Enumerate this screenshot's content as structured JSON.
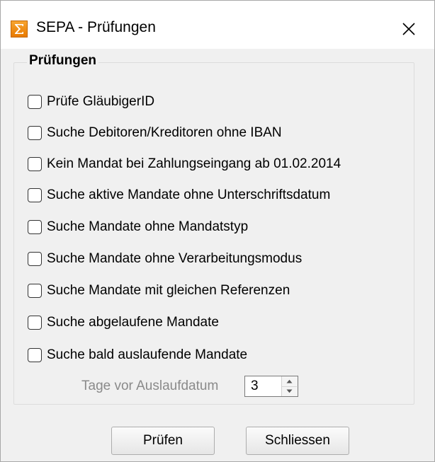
{
  "window": {
    "title": "SEPA - Prüfungen",
    "icon": "sigma-icon",
    "close_icon": "close-icon"
  },
  "group": {
    "legend": "Prüfungen"
  },
  "checks": [
    {
      "label": "Prüfe GläubigerID",
      "checked": false
    },
    {
      "label": "Suche Debitoren/Kreditoren ohne IBAN",
      "checked": false
    },
    {
      "label": "Kein Mandat bei Zahlungseingang ab 01.02.2014",
      "checked": false
    },
    {
      "label": "Suche aktive Mandate ohne Unterschriftsdatum",
      "checked": false
    },
    {
      "label": "Suche Mandate ohne Mandatstyp",
      "checked": false
    },
    {
      "label": "Suche Mandate ohne Verarbeitungsmodus",
      "checked": false
    },
    {
      "label": "Suche Mandate mit gleichen Referenzen",
      "checked": false
    },
    {
      "label": "Suche abgelaufene Mandate",
      "checked": false
    },
    {
      "label": "Suche bald auslaufende Mandate",
      "checked": false
    }
  ],
  "days": {
    "label": "Tage vor Auslaufdatum",
    "value": "3"
  },
  "buttons": {
    "check": "Prüfen",
    "close": "Schliessen"
  },
  "colors": {
    "icon_orange": "#f39a1f",
    "disabled_text": "#8a8a8a",
    "window_bg": "#f0f0f0"
  }
}
